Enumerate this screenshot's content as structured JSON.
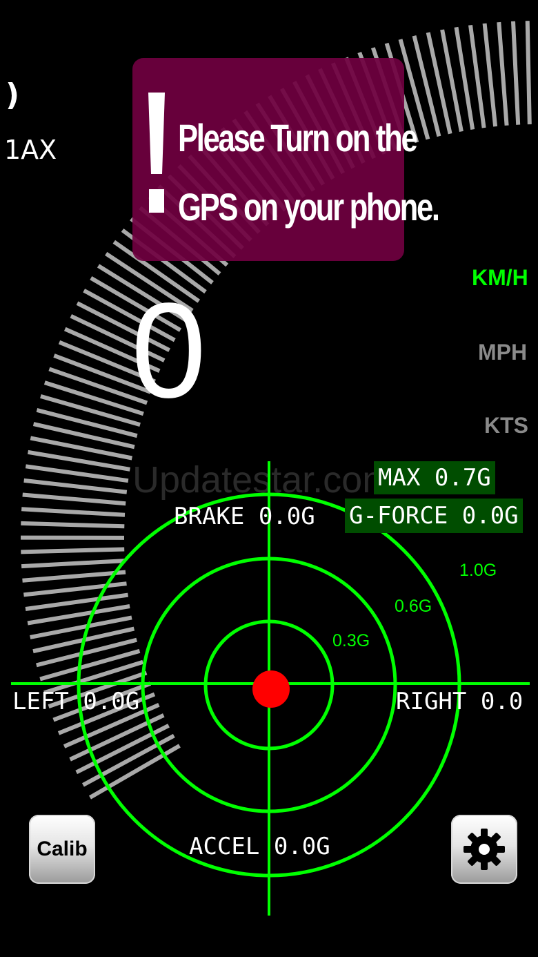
{
  "speedometer": {
    "left_max_value": ")",
    "left_max_label": "1AX",
    "speed_value": "0",
    "units": {
      "kmh": "KM/H",
      "mph": "MPH",
      "kts": "KTS"
    },
    "active_unit": "kmh",
    "arc_color": "#a9a9a9"
  },
  "gps_alert": {
    "line1": "Please Turn on the",
    "line2": "GPS on your phone.",
    "background_color": "#700040"
  },
  "watermark": "Updatestar.com",
  "gforce_meter": {
    "max_label": "MAX 0.7G",
    "current_label": "G-FORCE 0.0G",
    "brake_label": "BRAKE 0.0G",
    "accel_label": "ACCEL 0.0G",
    "left_label": "LEFT 0.0G",
    "right_label": "RIGHT 0.0",
    "rings": [
      "1.0G",
      "0.6G",
      "0.3G"
    ],
    "ring_color": "#00ff00",
    "dot_color": "#ff0000"
  },
  "buttons": {
    "calib_label": "Calib",
    "settings_icon": "gear-icon"
  }
}
